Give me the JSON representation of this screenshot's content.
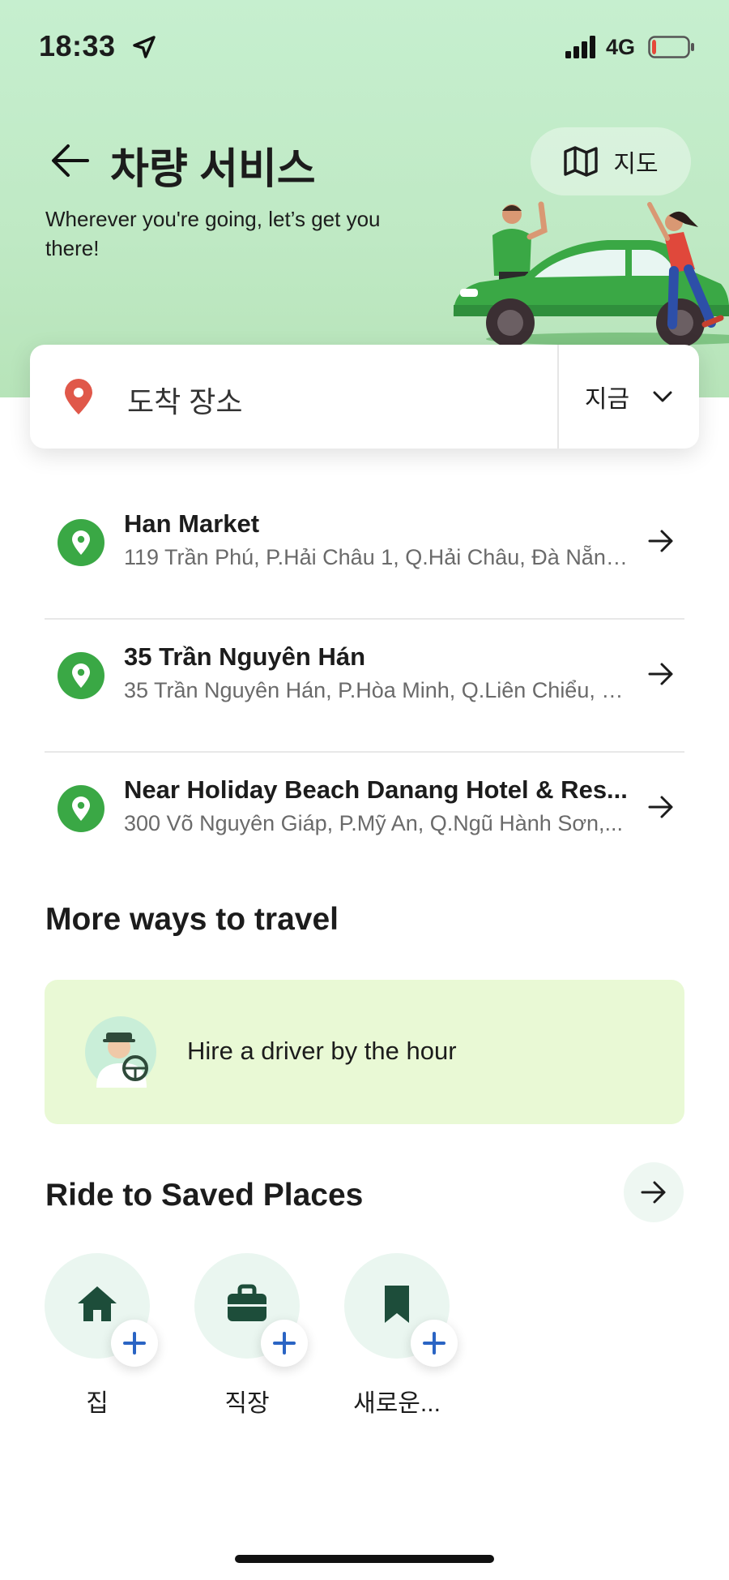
{
  "status_bar": {
    "time": "18:33",
    "network": "4G",
    "battery_level": 0.12,
    "battery_color": "#e5493a"
  },
  "header": {
    "title": "차량 서비스",
    "subtitle": "Wherever you're going, let’s get you there!",
    "map_button_label": "지도",
    "background_color": "#c6efcf"
  },
  "search": {
    "placeholder": "도착 장소",
    "time_option": "지금",
    "pin_color": "#e0584a"
  },
  "recent_places": [
    {
      "name": "Han Market",
      "address": "119 Trần Phú, P.Hải Châu 1, Q.Hải Châu, Đà Nẵng,..."
    },
    {
      "name": "35 Trần Nguyên Hán",
      "address": "35 Trần Nguyên Hán, P.Hòa Minh, Q.Liên Chiểu, Đ..."
    },
    {
      "name": "Near Holiday Beach Danang Hotel & Res...",
      "address": "300 Võ Nguyên Giáp, P.Mỹ An, Q.Ngũ Hành Sơn,..."
    }
  ],
  "more_ways": {
    "title": "More ways to travel",
    "hire_driver_label": "Hire a driver by the hour",
    "card_color": "#e9f9d5"
  },
  "saved_places": {
    "title": "Ride to Saved Places",
    "items": [
      {
        "label": "집",
        "icon": "home-icon"
      },
      {
        "label": "직장",
        "icon": "briefcase-icon"
      },
      {
        "label": "새로운...",
        "icon": "bookmark-icon"
      }
    ],
    "icon_color": "#1d4d3a",
    "plus_color": "#2a64c4"
  },
  "accent_color": "#3aa845"
}
